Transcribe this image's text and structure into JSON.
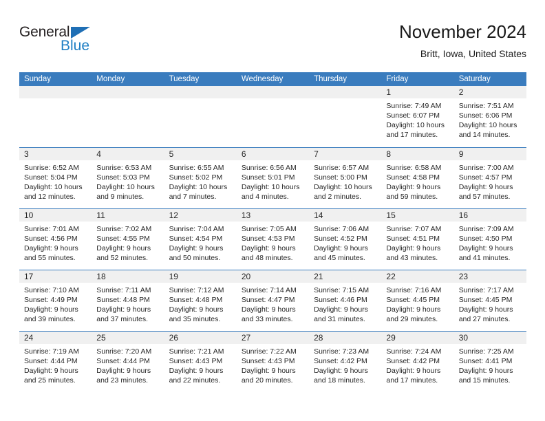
{
  "brand": {
    "name_part1": "General",
    "name_part2": "Blue",
    "flag_icon": "blue-triangle-flag"
  },
  "header": {
    "title": "November 2024",
    "location": "Britt, Iowa, United States"
  },
  "colors": {
    "header_blue": "#3a7cbe",
    "daynum_gray": "#f0f0f0",
    "brand_blue": "#1f7fc4",
    "text": "#262626"
  },
  "weekdays": [
    "Sunday",
    "Monday",
    "Tuesday",
    "Wednesday",
    "Thursday",
    "Friday",
    "Saturday"
  ],
  "labels": {
    "sunrise": "Sunrise:",
    "sunset": "Sunset:",
    "daylight": "Daylight:"
  },
  "weeks": [
    [
      {
        "day": "",
        "sunrise": "",
        "sunset": "",
        "daylight1": "",
        "daylight2": ""
      },
      {
        "day": "",
        "sunrise": "",
        "sunset": "",
        "daylight1": "",
        "daylight2": ""
      },
      {
        "day": "",
        "sunrise": "",
        "sunset": "",
        "daylight1": "",
        "daylight2": ""
      },
      {
        "day": "",
        "sunrise": "",
        "sunset": "",
        "daylight1": "",
        "daylight2": ""
      },
      {
        "day": "",
        "sunrise": "",
        "sunset": "",
        "daylight1": "",
        "daylight2": ""
      },
      {
        "day": "1",
        "sunrise": "Sunrise: 7:49 AM",
        "sunset": "Sunset: 6:07 PM",
        "daylight1": "Daylight: 10 hours",
        "daylight2": "and 17 minutes."
      },
      {
        "day": "2",
        "sunrise": "Sunrise: 7:51 AM",
        "sunset": "Sunset: 6:06 PM",
        "daylight1": "Daylight: 10 hours",
        "daylight2": "and 14 minutes."
      }
    ],
    [
      {
        "day": "3",
        "sunrise": "Sunrise: 6:52 AM",
        "sunset": "Sunset: 5:04 PM",
        "daylight1": "Daylight: 10 hours",
        "daylight2": "and 12 minutes."
      },
      {
        "day": "4",
        "sunrise": "Sunrise: 6:53 AM",
        "sunset": "Sunset: 5:03 PM",
        "daylight1": "Daylight: 10 hours",
        "daylight2": "and 9 minutes."
      },
      {
        "day": "5",
        "sunrise": "Sunrise: 6:55 AM",
        "sunset": "Sunset: 5:02 PM",
        "daylight1": "Daylight: 10 hours",
        "daylight2": "and 7 minutes."
      },
      {
        "day": "6",
        "sunrise": "Sunrise: 6:56 AM",
        "sunset": "Sunset: 5:01 PM",
        "daylight1": "Daylight: 10 hours",
        "daylight2": "and 4 minutes."
      },
      {
        "day": "7",
        "sunrise": "Sunrise: 6:57 AM",
        "sunset": "Sunset: 5:00 PM",
        "daylight1": "Daylight: 10 hours",
        "daylight2": "and 2 minutes."
      },
      {
        "day": "8",
        "sunrise": "Sunrise: 6:58 AM",
        "sunset": "Sunset: 4:58 PM",
        "daylight1": "Daylight: 9 hours",
        "daylight2": "and 59 minutes."
      },
      {
        "day": "9",
        "sunrise": "Sunrise: 7:00 AM",
        "sunset": "Sunset: 4:57 PM",
        "daylight1": "Daylight: 9 hours",
        "daylight2": "and 57 minutes."
      }
    ],
    [
      {
        "day": "10",
        "sunrise": "Sunrise: 7:01 AM",
        "sunset": "Sunset: 4:56 PM",
        "daylight1": "Daylight: 9 hours",
        "daylight2": "and 55 minutes."
      },
      {
        "day": "11",
        "sunrise": "Sunrise: 7:02 AM",
        "sunset": "Sunset: 4:55 PM",
        "daylight1": "Daylight: 9 hours",
        "daylight2": "and 52 minutes."
      },
      {
        "day": "12",
        "sunrise": "Sunrise: 7:04 AM",
        "sunset": "Sunset: 4:54 PM",
        "daylight1": "Daylight: 9 hours",
        "daylight2": "and 50 minutes."
      },
      {
        "day": "13",
        "sunrise": "Sunrise: 7:05 AM",
        "sunset": "Sunset: 4:53 PM",
        "daylight1": "Daylight: 9 hours",
        "daylight2": "and 48 minutes."
      },
      {
        "day": "14",
        "sunrise": "Sunrise: 7:06 AM",
        "sunset": "Sunset: 4:52 PM",
        "daylight1": "Daylight: 9 hours",
        "daylight2": "and 45 minutes."
      },
      {
        "day": "15",
        "sunrise": "Sunrise: 7:07 AM",
        "sunset": "Sunset: 4:51 PM",
        "daylight1": "Daylight: 9 hours",
        "daylight2": "and 43 minutes."
      },
      {
        "day": "16",
        "sunrise": "Sunrise: 7:09 AM",
        "sunset": "Sunset: 4:50 PM",
        "daylight1": "Daylight: 9 hours",
        "daylight2": "and 41 minutes."
      }
    ],
    [
      {
        "day": "17",
        "sunrise": "Sunrise: 7:10 AM",
        "sunset": "Sunset: 4:49 PM",
        "daylight1": "Daylight: 9 hours",
        "daylight2": "and 39 minutes."
      },
      {
        "day": "18",
        "sunrise": "Sunrise: 7:11 AM",
        "sunset": "Sunset: 4:48 PM",
        "daylight1": "Daylight: 9 hours",
        "daylight2": "and 37 minutes."
      },
      {
        "day": "19",
        "sunrise": "Sunrise: 7:12 AM",
        "sunset": "Sunset: 4:48 PM",
        "daylight1": "Daylight: 9 hours",
        "daylight2": "and 35 minutes."
      },
      {
        "day": "20",
        "sunrise": "Sunrise: 7:14 AM",
        "sunset": "Sunset: 4:47 PM",
        "daylight1": "Daylight: 9 hours",
        "daylight2": "and 33 minutes."
      },
      {
        "day": "21",
        "sunrise": "Sunrise: 7:15 AM",
        "sunset": "Sunset: 4:46 PM",
        "daylight1": "Daylight: 9 hours",
        "daylight2": "and 31 minutes."
      },
      {
        "day": "22",
        "sunrise": "Sunrise: 7:16 AM",
        "sunset": "Sunset: 4:45 PM",
        "daylight1": "Daylight: 9 hours",
        "daylight2": "and 29 minutes."
      },
      {
        "day": "23",
        "sunrise": "Sunrise: 7:17 AM",
        "sunset": "Sunset: 4:45 PM",
        "daylight1": "Daylight: 9 hours",
        "daylight2": "and 27 minutes."
      }
    ],
    [
      {
        "day": "24",
        "sunrise": "Sunrise: 7:19 AM",
        "sunset": "Sunset: 4:44 PM",
        "daylight1": "Daylight: 9 hours",
        "daylight2": "and 25 minutes."
      },
      {
        "day": "25",
        "sunrise": "Sunrise: 7:20 AM",
        "sunset": "Sunset: 4:44 PM",
        "daylight1": "Daylight: 9 hours",
        "daylight2": "and 23 minutes."
      },
      {
        "day": "26",
        "sunrise": "Sunrise: 7:21 AM",
        "sunset": "Sunset: 4:43 PM",
        "daylight1": "Daylight: 9 hours",
        "daylight2": "and 22 minutes."
      },
      {
        "day": "27",
        "sunrise": "Sunrise: 7:22 AM",
        "sunset": "Sunset: 4:43 PM",
        "daylight1": "Daylight: 9 hours",
        "daylight2": "and 20 minutes."
      },
      {
        "day": "28",
        "sunrise": "Sunrise: 7:23 AM",
        "sunset": "Sunset: 4:42 PM",
        "daylight1": "Daylight: 9 hours",
        "daylight2": "and 18 minutes."
      },
      {
        "day": "29",
        "sunrise": "Sunrise: 7:24 AM",
        "sunset": "Sunset: 4:42 PM",
        "daylight1": "Daylight: 9 hours",
        "daylight2": "and 17 minutes."
      },
      {
        "day": "30",
        "sunrise": "Sunrise: 7:25 AM",
        "sunset": "Sunset: 4:41 PM",
        "daylight1": "Daylight: 9 hours",
        "daylight2": "and 15 minutes."
      }
    ]
  ]
}
